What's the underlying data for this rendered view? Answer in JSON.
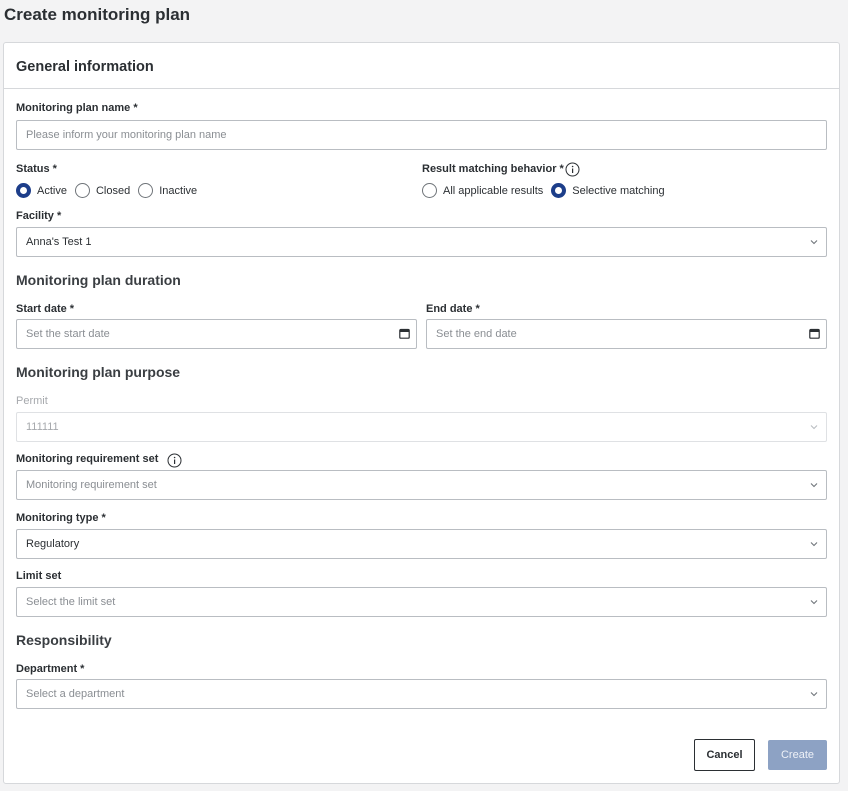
{
  "page": {
    "title": "Create monitoring plan"
  },
  "general": {
    "header": "General information",
    "plan_name": {
      "label": "Monitoring plan name *",
      "placeholder": "Please inform your monitoring plan name",
      "value": ""
    },
    "status": {
      "label": "Status *",
      "options": [
        {
          "label": "Active",
          "checked": true
        },
        {
          "label": "Closed",
          "checked": false
        },
        {
          "label": "Inactive",
          "checked": false
        }
      ]
    },
    "result_matching": {
      "label": "Result matching behavior *",
      "options": [
        {
          "label": "All applicable results",
          "checked": false
        },
        {
          "label": "Selective matching",
          "checked": true
        }
      ]
    },
    "facility": {
      "label": "Facility *",
      "value": "Anna's Test 1"
    }
  },
  "duration": {
    "title": "Monitoring plan duration",
    "start": {
      "label": "Start date *",
      "placeholder": "Set the start date"
    },
    "end": {
      "label": "End date *",
      "placeholder": "Set the end date"
    }
  },
  "purpose": {
    "title": "Monitoring plan purpose",
    "permit": {
      "label": "Permit",
      "value": "111111"
    },
    "requirement_set": {
      "label": "Monitoring requirement set",
      "placeholder": "Monitoring requirement set"
    },
    "monitoring_type": {
      "label": "Monitoring type *",
      "value": "Regulatory"
    },
    "limit_set": {
      "label": "Limit set",
      "placeholder": "Select the limit set"
    }
  },
  "responsibility": {
    "title": "Responsibility",
    "department": {
      "label": "Department *",
      "placeholder": "Select a department"
    }
  },
  "actions": {
    "cancel": "Cancel",
    "create": "Create"
  },
  "colors": {
    "accent": "#1d3e8a",
    "create_disabled": "#8da2c4",
    "border": "#b9bdc2"
  }
}
